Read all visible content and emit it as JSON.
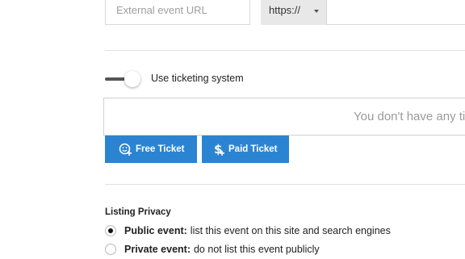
{
  "event_url": {
    "placeholder": "External event URL",
    "protocol": "https://"
  },
  "ticketing": {
    "toggle_label": "Use ticketing system",
    "enabled": false,
    "empty_message": "You don't have any tickets"
  },
  "buttons": {
    "free_ticket": "Free Ticket",
    "paid_ticket": "Paid Ticket"
  },
  "privacy": {
    "title": "Listing Privacy",
    "options": [
      {
        "label": "Public event:",
        "description": "list this event on this site and search engines",
        "checked": true
      },
      {
        "label": "Private event:",
        "description": "do not list this event publicly",
        "checked": false
      }
    ]
  },
  "colors": {
    "accent": "#2b84d2"
  }
}
